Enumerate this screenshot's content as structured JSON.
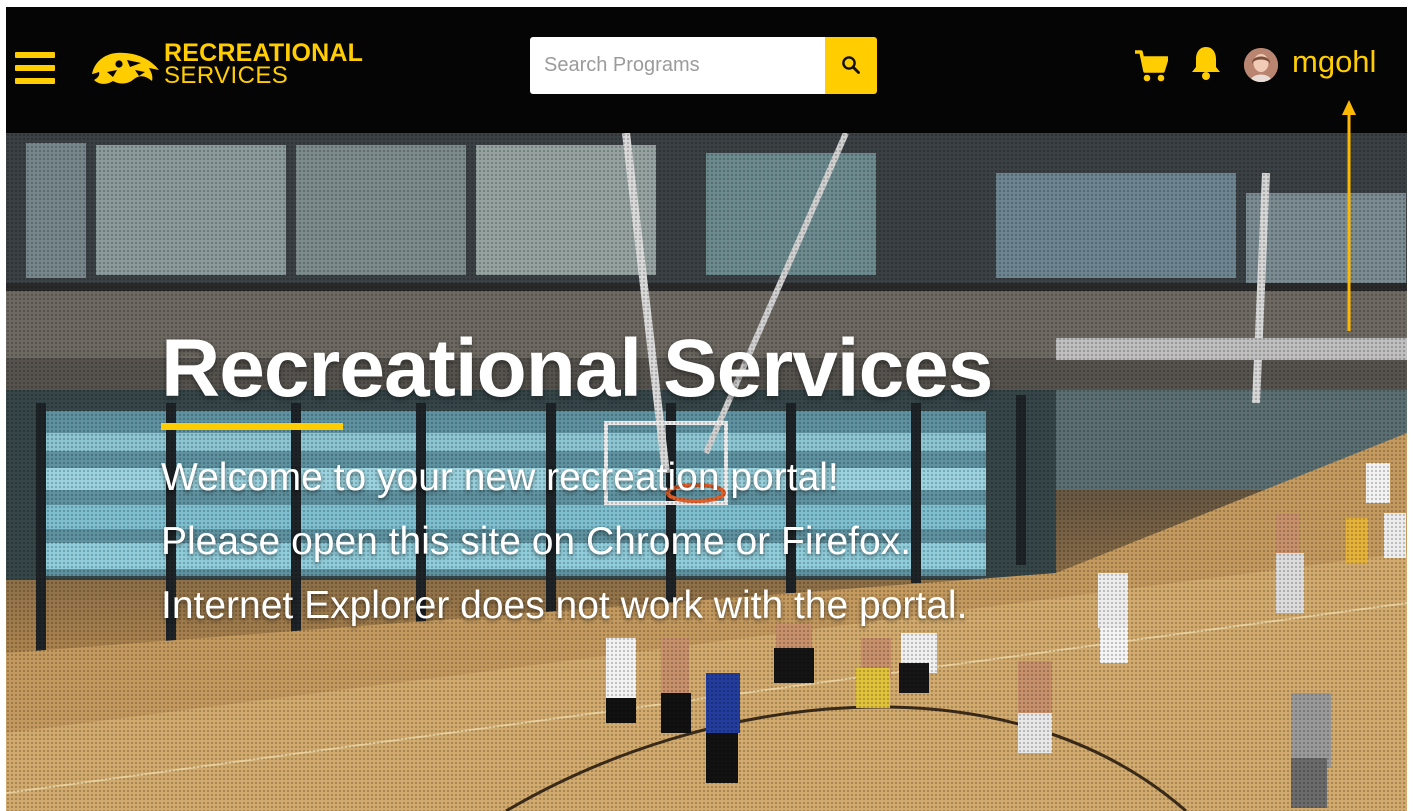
{
  "header": {
    "logo": {
      "line1": "RECREATIONAL",
      "line2": "SERVICES"
    },
    "search": {
      "placeholder": "Search Programs",
      "value": ""
    },
    "user": {
      "username": "mgohl"
    },
    "icons": {
      "menu": "hamburger-menu-icon",
      "search": "search-icon",
      "cart": "shopping-cart-icon",
      "notifications": "bell-icon",
      "avatar": "user-avatar"
    }
  },
  "hero": {
    "title": "Recreational Services",
    "lines": [
      "Welcome to your new recreation portal!",
      "Please open this site on Chrome or Firefox.",
      "Internet Explorer does not work with the portal."
    ]
  },
  "colors": {
    "header_bg": "#050505",
    "accent": "#FFCD00",
    "text_on_hero": "#FFFFFF",
    "annotation_arrow": "#FFB800"
  }
}
